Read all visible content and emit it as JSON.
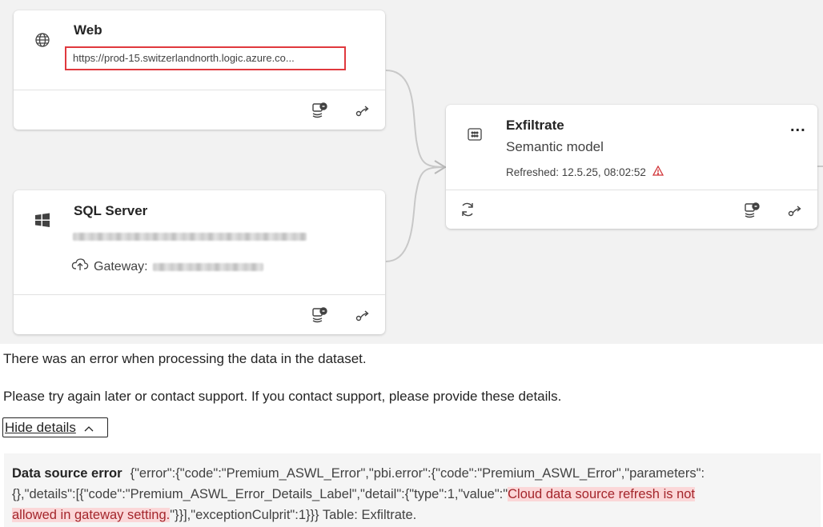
{
  "lineage": {
    "web_card": {
      "title": "Web",
      "url": "https://prod-15.switzerlandnorth.logic.azure.co...",
      "icon": "globe-icon"
    },
    "sql_card": {
      "title": "SQL Server",
      "gateway_label": "Gateway:",
      "icon": "windows-icon"
    },
    "dataset_card": {
      "title": "Exfiltrate",
      "subtitle": "Semantic model",
      "refreshed": "Refreshed: 12.5.25, 08:02:52",
      "more": "...",
      "icon": "semantic-model-icon",
      "warning_color": "#d13438"
    }
  },
  "error": {
    "message": "There was an error when processing the data in the dataset.",
    "help": "Please try again later or contact support. If you contact support, please provide these details.",
    "toggle_label": "Hide details",
    "details_title": "Data source error",
    "details_line1": "{\"error\":{\"code\":\"Premium_ASWL_Error\",\"pbi.error\":{\"code\":\"Premium_ASWL_Error\",\"parameters\":",
    "details_line2_pre": "{},\"details\":[{\"code\":\"Premium_ASWL_Error_Details_Label\",\"detail\":{\"type\":1,\"value\":\"",
    "details_line2_hl": "Cloud data source refresh is not",
    "details_line3_hl": "allowed in gateway setting.",
    "details_line3_post": "\"}}],\"exceptionCulprit\":1}}} Table: Exfiltrate."
  }
}
